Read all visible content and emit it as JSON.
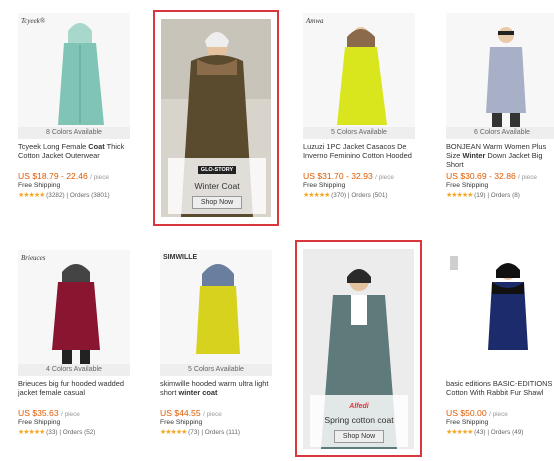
{
  "row1": [
    {
      "brand": "Tcyeek®",
      "colors": "8 Colors Available",
      "title_pre": "Tcyeek Long Female ",
      "title_bold": "Coat",
      "title_post": " Thick Cotton Jacket Outerwear",
      "price": "US $18.79 - 22.46",
      "unit": "/ piece",
      "shipping": "Free Shipping",
      "reviews": "(3282)",
      "orders": "Orders (3801)",
      "accent": "#7fc4b4"
    },
    {
      "brand": "Amwa",
      "colors": "5 Colors Available",
      "title_pre": "Luzuzi 1PC Jacket Casacos De Inverno Feminino Cotton Hooded",
      "title_bold": "",
      "title_post": "",
      "price": "US $31.70 - 32.93",
      "unit": "/ piece",
      "shipping": "Free Shipping",
      "reviews": "(370)",
      "orders": "Orders (501)",
      "accent": "#d9e61e"
    },
    {
      "brand": "",
      "colors": "6 Colors Available",
      "title_pre": "BONJEAN Warm Women Plus Size ",
      "title_bold": "Winter",
      "title_post": " Down Jacket Big Short",
      "price": "US $30.69 - 32.86",
      "unit": "/ piece",
      "shipping": "Free Shipping",
      "reviews": "(19)",
      "orders": "Orders (8)",
      "accent": "#a8b0c8"
    }
  ],
  "row2": [
    {
      "brand": "Brieuces",
      "colors": "4 Colors Available",
      "title_pre": "Brieuces big fur hooded wadded jacket female casual",
      "title_bold": "",
      "title_post": "",
      "price": "US $35.63",
      "unit": "/ piece",
      "shipping": "Free Shipping",
      "reviews": "(33)",
      "orders": "Orders (52)",
      "accent": "#8a1530"
    },
    {
      "brand": "SIMWILLE",
      "colors": "5 Colors Available",
      "title_pre": "skimwille hooded warm ultra light short ",
      "title_bold": "winter coat",
      "title_post": "",
      "price": "US $44.55",
      "unit": "/ piece",
      "shipping": "Free Shipping",
      "reviews": "(73)",
      "orders": "Orders (111)",
      "accent": "#d7d21e"
    },
    {
      "brand": "",
      "colors": "",
      "title_pre": "basic editions BASIC-EDITIONS Cotton With Rabbit Fur Shawl",
      "title_bold": "",
      "title_post": "",
      "price": "US $50.00",
      "unit": "/ piece",
      "shipping": "Free Shipping",
      "reviews": "(43)",
      "orders": "Orders (49)",
      "accent": "#1c2b6b"
    }
  ],
  "promo1": {
    "logo": "GLO-STORY",
    "name": "Winter Coat",
    "button": "Shop Now",
    "accent": "#5a4a2e"
  },
  "promo2": {
    "logo": "Alfedi",
    "name": "Spring cotton coat",
    "button": "Shop Now",
    "accent": "#5f7a7a"
  },
  "stars": "★★★★★",
  "colors": {
    "price": "#e05a00",
    "highlight_border": "#d9363e",
    "star": "#f5a623"
  }
}
